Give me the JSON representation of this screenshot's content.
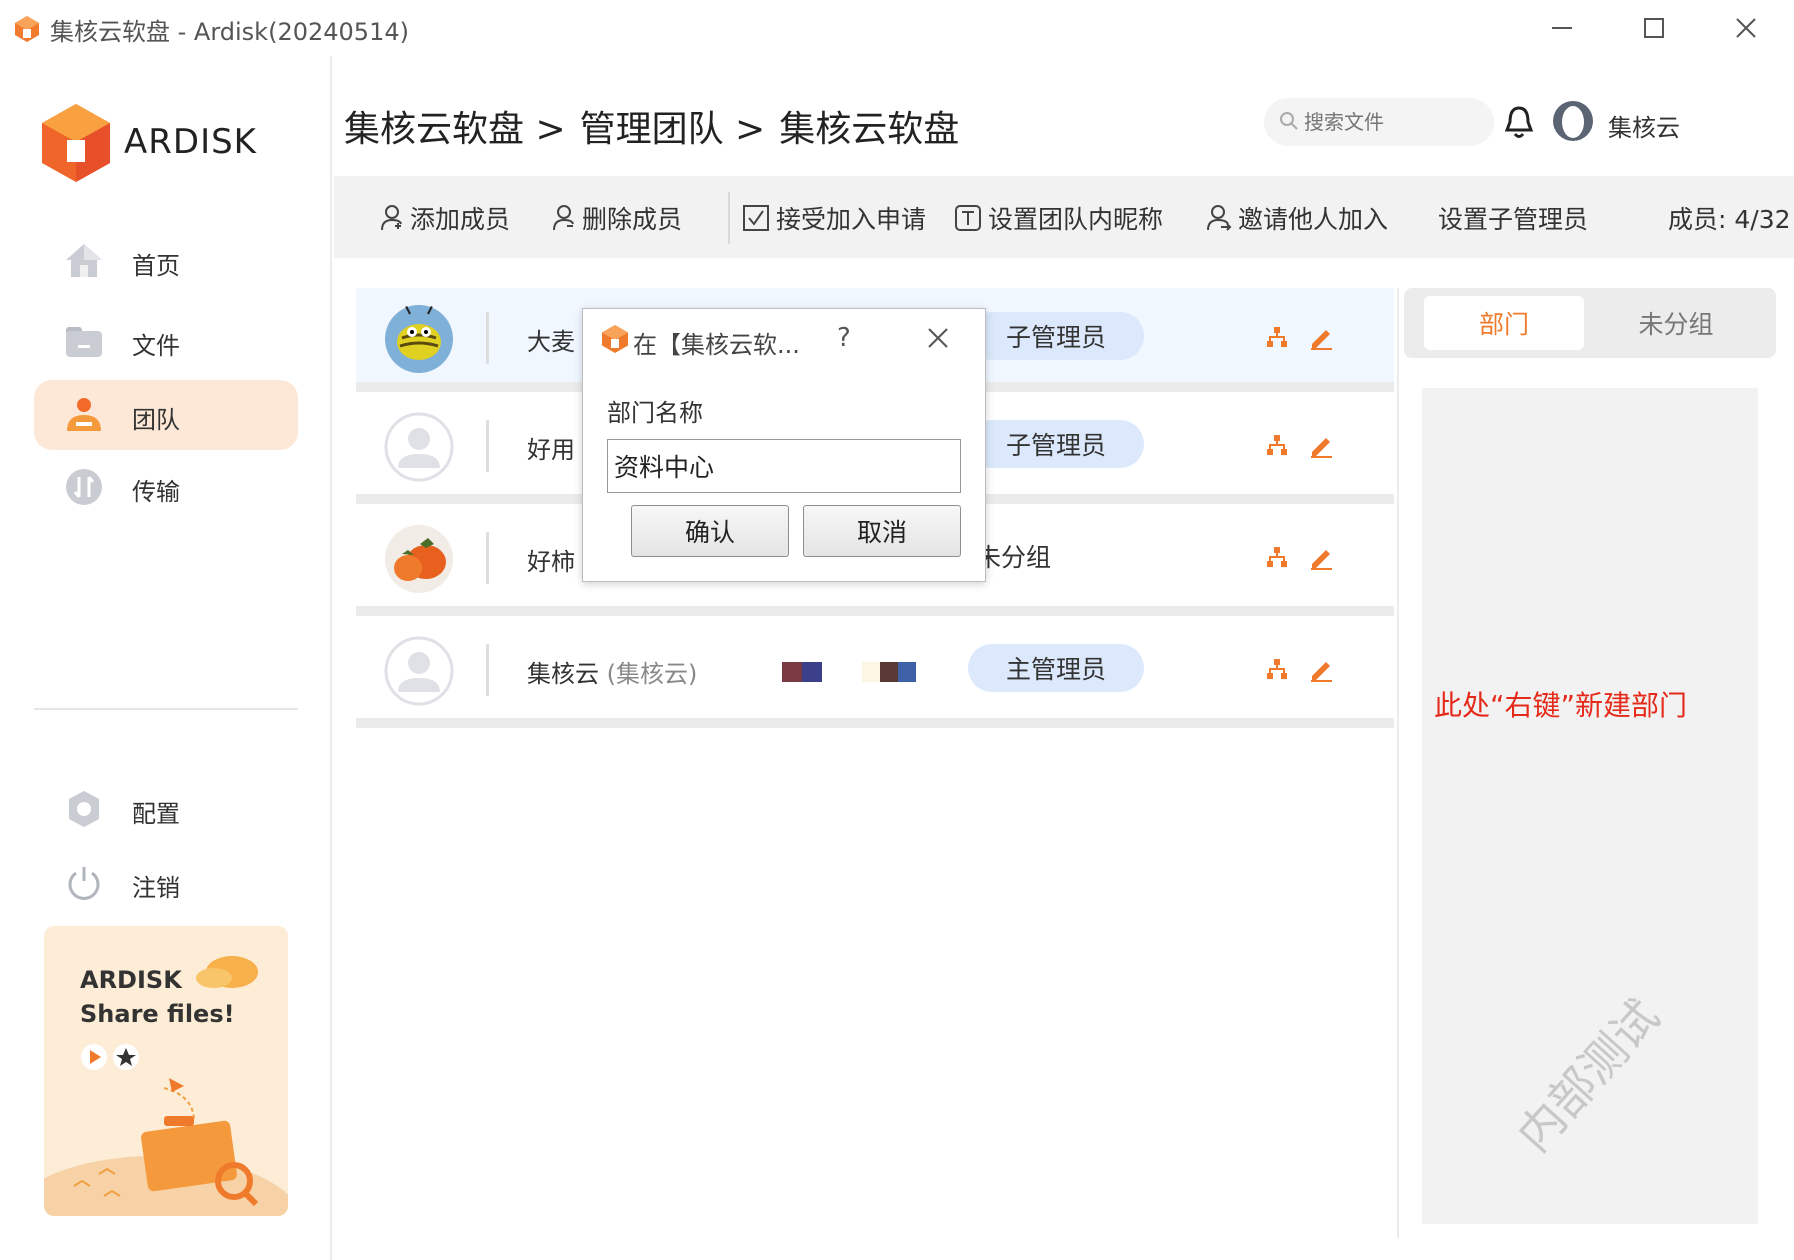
{
  "window": {
    "title": "集核云软盘 - Ardisk(20240514)",
    "minimize_label": "minimize",
    "maximize_label": "maximize",
    "close_label": "close"
  },
  "sidebar": {
    "logo_text": "ARDISK",
    "items": [
      {
        "label": "首页",
        "icon": "home-icon"
      },
      {
        "label": "文件",
        "icon": "folder-icon"
      },
      {
        "label": "团队",
        "icon": "team-icon",
        "active": true
      },
      {
        "label": "传输",
        "icon": "transfer-icon"
      }
    ],
    "bottom_items": [
      {
        "label": "配置",
        "icon": "gear-icon"
      },
      {
        "label": "注销",
        "icon": "power-icon"
      }
    ],
    "promo": {
      "line1": "ARDISK",
      "line2": "Share files!"
    }
  },
  "header": {
    "breadcrumb": [
      "集核云软盘 >",
      "管理团队 >",
      "集核云软盘"
    ],
    "search_placeholder": "搜索文件",
    "user_name": "集核云"
  },
  "toolbar": {
    "add_member": "添加成员",
    "delete_member": "删除成员",
    "accept_requests": "接受加入申请",
    "set_nickname": "设置团队内昵称",
    "invite": "邀请他人加入",
    "set_sub_admin": "设置子管理员",
    "members_count": "成员: 4/32"
  },
  "members": [
    {
      "name": "大麦",
      "alias": "",
      "role": "子管理员",
      "role_style": "pill",
      "avatar": "bee"
    },
    {
      "name": "好用",
      "alias": "",
      "role": "子管理员",
      "role_style": "pill",
      "avatar": "default"
    },
    {
      "name": "好柿",
      "alias": "",
      "role": "未分组",
      "role_style": "plain",
      "avatar": "persimmon"
    },
    {
      "name": "集核云",
      "alias": "(集核云)",
      "role": "主管理员",
      "role_style": "pill",
      "avatar": "default"
    }
  ],
  "right_panel": {
    "tabs": [
      "部门",
      "未分组"
    ],
    "active_tab": 0,
    "hint": "此处“右键”新建部门",
    "watermark": "内部测试"
  },
  "dialog": {
    "title": "在【集核云软...",
    "help": "?",
    "label": "部门名称",
    "input_value": "资料中心",
    "confirm": "确认",
    "cancel": "取消"
  },
  "colors": {
    "accent": "#f07a2c",
    "active_nav_bg": "#fde8d7",
    "role_pill_bg": "#dce8fb",
    "hint_red": "#e62a1a"
  }
}
